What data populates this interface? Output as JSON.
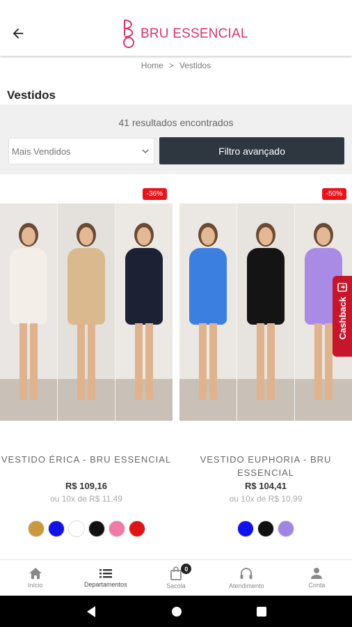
{
  "header": {
    "back_icon": "arrow-left-icon",
    "logo_text": "BRU ESSENCIAL",
    "brand_color": "#d6336c"
  },
  "breadcrumb": {
    "home": "Home",
    "separator": ">",
    "current": "Vestidos"
  },
  "page": {
    "title": "Vestidos"
  },
  "filters": {
    "results_text": "41 resultados encontrados",
    "sort_value": "Mais Vendidos",
    "advanced_filter_label": "Filtro avançado"
  },
  "products": [
    {
      "discount": "-36%",
      "name": "VESTIDO ÉRICA - BRU ESSENCIAL",
      "price": "R$ 109,16",
      "installments": "ou 10x de R$ 11,49",
      "swatches": [
        "#c9983f",
        "#1212e6",
        "#ffffff",
        "#111111",
        "#f07aa8",
        "#e01414"
      ],
      "dress_colors": [
        "#f3efe8",
        "#d9b98d",
        "#1c2233"
      ]
    },
    {
      "discount": "-50%",
      "name": "VESTIDO EUPHORIA - BRU ESSENCIAL",
      "price": "R$ 104,41",
      "installments": "ou 10x de R$ 10,99",
      "swatches": [
        "#1111ee",
        "#111111",
        "#9f86e0"
      ],
      "dress_colors": [
        "#3b7fe0",
        "#141414",
        "#a98be6"
      ]
    }
  ],
  "cashback": {
    "label": "Cashback",
    "icon": "cashback-icon"
  },
  "bottom_nav": [
    {
      "label": "Início",
      "icon": "home-icon"
    },
    {
      "label": "Departamentos",
      "icon": "list-icon"
    },
    {
      "label": "Sacola",
      "icon": "bag-icon",
      "badge": "0"
    },
    {
      "label": "Atendimento",
      "icon": "headset-icon"
    },
    {
      "label": "Conta",
      "icon": "user-icon"
    }
  ],
  "android_nav": [
    "back-icon",
    "home-circle-icon",
    "recents-icon"
  ]
}
